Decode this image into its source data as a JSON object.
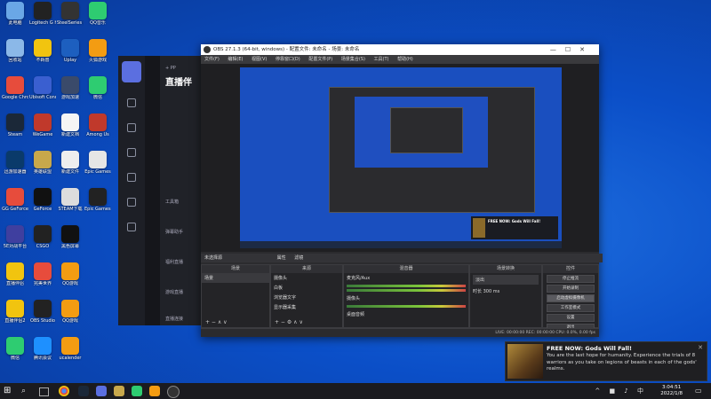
{
  "desktop_icons": [
    {
      "label": "此电脑",
      "color": "#6aa7e6"
    },
    {
      "label": "Logitech G HUB",
      "color": "#222"
    },
    {
      "label": "SteelSeries GG",
      "color": "#333"
    },
    {
      "label": "QQ音乐",
      "color": "#2ecc71"
    },
    {
      "label": "回收站",
      "color": "#8bb8e8"
    },
    {
      "label": "不羁兽",
      "color": "#f1c40f"
    },
    {
      "label": "Uplay",
      "color": "#1d5fbf"
    },
    {
      "label": "火狐游戏",
      "color": "#f39c12"
    },
    {
      "label": "Google Chrome",
      "color": "#e74c3c"
    },
    {
      "label": "Ubisoft Connect",
      "color": "#3a5fd0"
    },
    {
      "label": "游戏加速",
      "color": "#3a4a6a"
    },
    {
      "label": "微信",
      "color": "#2ecc71"
    },
    {
      "label": "Steam",
      "color": "#1b2838"
    },
    {
      "label": "WeGame",
      "color": "#c0392b"
    },
    {
      "label": "新建文档",
      "color": "#f5f5f5"
    },
    {
      "label": "Among Us",
      "color": "#c0392b"
    },
    {
      "label": "迅游加速器",
      "color": "#0a3a6a"
    },
    {
      "label": "英雄联盟",
      "color": "#c8a84b"
    },
    {
      "label": "新建文件",
      "color": "#eee"
    },
    {
      "label": "Epic Games",
      "color": "#e5e5e5"
    },
    {
      "label": "GG GeForce",
      "color": "#e74c3c"
    },
    {
      "label": "GeForce",
      "color": "#111"
    },
    {
      "label": "STEAM下载",
      "color": "#ddd"
    },
    {
      "label": "Epic Games Launcher",
      "color": "#222"
    },
    {
      "label": "5E对战平台",
      "color": "#3f3f9f"
    },
    {
      "label": "CSGO",
      "color": "#222"
    },
    {
      "label": "黑色屏幕",
      "color": "#111"
    },
    {
      "label": "",
      "color": "#000"
    },
    {
      "label": "直播伴侣",
      "color": "#f1c40f"
    },
    {
      "label": "完美世界",
      "color": "#e74c3c"
    },
    {
      "label": "QQ游戏",
      "color": "#f39c12"
    },
    {
      "label": "",
      "color": "#000"
    },
    {
      "label": "直播伴侣2",
      "color": "#f1c40f"
    },
    {
      "label": "OBS Studio",
      "color": "#222"
    },
    {
      "label": "QQ游戏",
      "color": "#f39c12"
    },
    {
      "label": "",
      "color": "#000"
    },
    {
      "label": "微信",
      "color": "#2ecc71"
    },
    {
      "label": "腾讯会议",
      "color": "#1e90ff"
    },
    {
      "label": "ucalender",
      "color": "#f39c12"
    },
    {
      "label": "",
      "color": "#000"
    }
  ],
  "live_app": {
    "title": "直播伴",
    "items": [
      "+ PP",
      "工具箱",
      "弹幕助手",
      "福利直播",
      "游戏直播",
      "礼物",
      "直播连接"
    ],
    "colors": {
      "rail": "#1d1f26",
      "accent": "#5b6fe0"
    }
  },
  "obs": {
    "window_title": "OBS 27.1.3 (64-bit, windows) - 配置文件: 未命名 - 场景: 未命名",
    "menu": [
      "文件(F)",
      "编辑(E)",
      "视图(V)",
      "停靠窗口(D)",
      "配置文件(P)",
      "场景集合(S)",
      "工具(T)",
      "帮助(H)"
    ],
    "window_controls": [
      "—",
      "☐",
      "✕"
    ],
    "no_source": "未选择源",
    "properties": "属性",
    "filters": "滤镜",
    "docks": {
      "scenes": {
        "title": "场景",
        "items": [
          "场景"
        ]
      },
      "sources": {
        "title": "来源",
        "items": [
          "摄像头",
          "白板",
          "浏览器文字",
          "显示器采集"
        ]
      },
      "mixer": {
        "title": "混音器",
        "channels": [
          {
            "name": "麦克风/Aux",
            "db": "0.0 dB"
          },
          {
            "name": "摄像头",
            "db": "0.0 dB"
          },
          {
            "name": "桌面音频",
            "db": "0.0 dB"
          }
        ]
      },
      "transitions": {
        "title": "场景转换",
        "type": "淡出",
        "duration_label": "时长",
        "duration": "300 ms"
      },
      "controls": {
        "title": "控件",
        "buttons": [
          "停止推流",
          "开始录制",
          "启动虚拟摄像机",
          "工作室模式",
          "设置",
          "退出"
        ],
        "active_index": 2
      }
    },
    "status": "LIVE: 00:00:00  REC: 00:00:00  CPU: 0.0%, 0.00 fps"
  },
  "notification": {
    "title": "FREE NOW: Gods Will Fall!",
    "body": "You are the last hope for humanity. Experience the trials of 8 warriors as you take on legions of beasts in each of the gods' realms.",
    "close": "✕"
  },
  "taskbar": {
    "time": "3:04:51",
    "date": "2022/1/8",
    "tray": "^ ■ ♪ 中"
  }
}
